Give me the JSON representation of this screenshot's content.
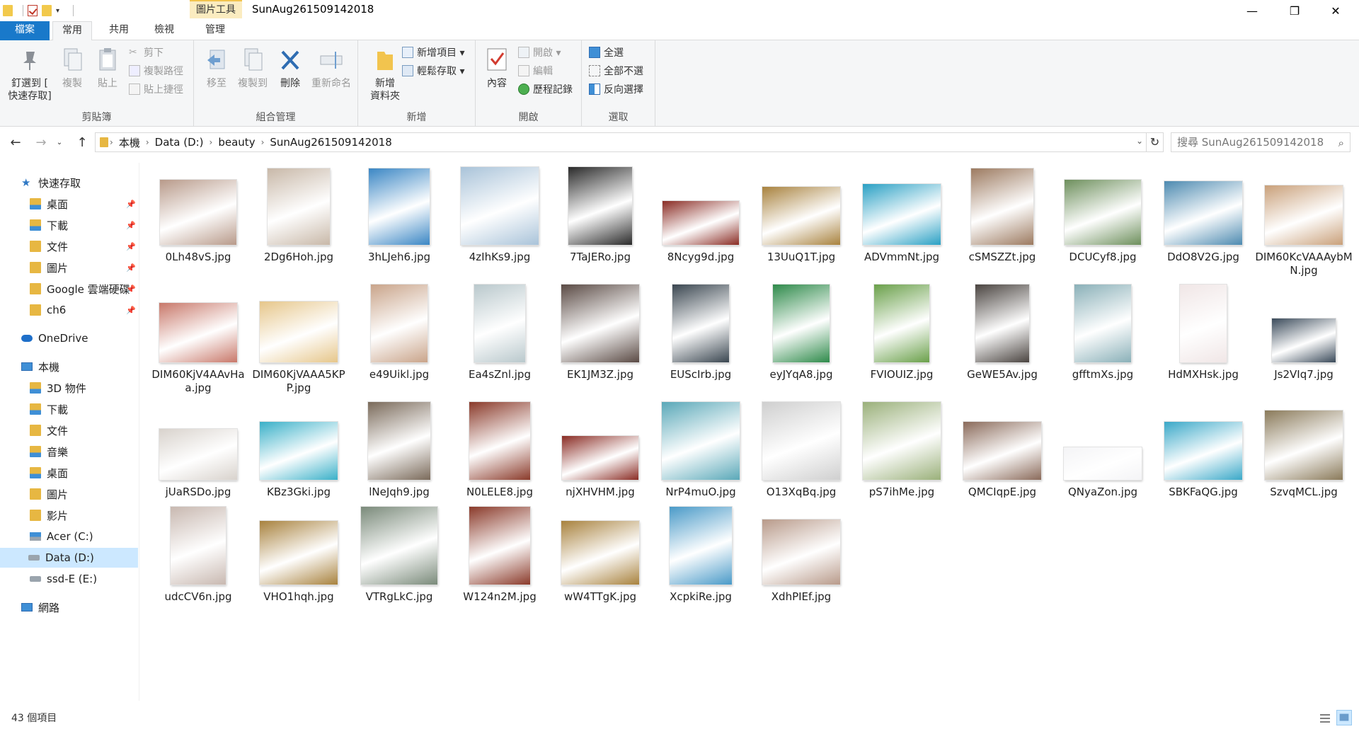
{
  "window": {
    "title": "SunAug261509142018",
    "tool_tab": "圖片工具",
    "minimize": "—",
    "restore": "❐",
    "close": "✕"
  },
  "tabs": {
    "file": "檔案",
    "home": "常用",
    "share": "共用",
    "view": "檢視",
    "manage": "管理"
  },
  "ribbon": {
    "clipboard": {
      "label": "剪貼簿",
      "pin": "釘選到 [\n快速存取]",
      "copy": "複製",
      "paste": "貼上",
      "cut": "剪下",
      "copy_path": "複製路徑",
      "paste_shortcut": "貼上捷徑"
    },
    "organize": {
      "label": "組合管理",
      "move": "移至",
      "copy_to": "複製到",
      "delete": "刪除",
      "rename": "重新命名"
    },
    "new": {
      "label": "新增",
      "new_folder": "新增\n資料夾",
      "new_item": "新增項目 ▾",
      "easy_access": "輕鬆存取 ▾"
    },
    "open": {
      "label": "開啟",
      "properties": "內容",
      "open": "開啟 ▾",
      "edit": "編輯",
      "history": "歷程記錄"
    },
    "select": {
      "label": "選取",
      "select_all": "全選",
      "select_none": "全部不選",
      "invert": "反向選擇"
    }
  },
  "address": {
    "crumbs": [
      "本機",
      "Data (D:)",
      "beauty",
      "SunAug261509142018"
    ],
    "search_placeholder": "搜尋 SunAug261509142018"
  },
  "sidebar": {
    "quick_access": "快速存取",
    "qa_items": [
      "桌面",
      "下載",
      "文件",
      "圖片",
      "Google 雲端硬碟",
      "ch6"
    ],
    "onedrive": "OneDrive",
    "this_pc": "本機",
    "pc_items": [
      "3D 物件",
      "下載",
      "文件",
      "音樂",
      "桌面",
      "圖片",
      "影片",
      "Acer (C:)",
      "Data (D:)",
      "ssd-E (E:)"
    ],
    "network": "網路"
  },
  "files": [
    {
      "name": "0Lh48vS.jpg",
      "color": "#b89a8a"
    },
    {
      "name": "2Dg6Hoh.jpg",
      "color": "#c8b8a8"
    },
    {
      "name": "3hLJeh6.jpg",
      "color": "#3a86c4"
    },
    {
      "name": "4zIhKs9.jpg",
      "color": "#a9c3d9"
    },
    {
      "name": "7TaJERo.jpg",
      "color": "#2a2a2a"
    },
    {
      "name": "8Ncyg9d.jpg",
      "color": "#8a2c24"
    },
    {
      "name": "13UuQ1T.jpg",
      "color": "#a8823e"
    },
    {
      "name": "ADVmmNt.jpg",
      "color": "#2aa0c4"
    },
    {
      "name": "cSMSZZt.jpg",
      "color": "#9c7a60"
    },
    {
      "name": "DCUCyf8.jpg",
      "color": "#6d8f5c"
    },
    {
      "name": "DdO8V2G.jpg",
      "color": "#4d8ab0"
    },
    {
      "name": "DIM60KcVAAAybMN.jpg",
      "color": "#c9a07a"
    },
    {
      "name": "DIM60KjV4AAvHaa.jpg",
      "color": "#c8786a"
    },
    {
      "name": "DIM60KjVAAA5KPP.jpg",
      "color": "#e6c68a"
    },
    {
      "name": "e49Uikl.jpg",
      "color": "#c9a48a"
    },
    {
      "name": "Ea4sZnl.jpg",
      "color": "#b9c8cc"
    },
    {
      "name": "EK1JM3Z.jpg",
      "color": "#5a4a44"
    },
    {
      "name": "EUScIrb.jpg",
      "color": "#3a4650"
    },
    {
      "name": "eyJYqA8.jpg",
      "color": "#2e8a4a"
    },
    {
      "name": "FVIOUIZ.jpg",
      "color": "#6aa04a"
    },
    {
      "name": "GeWE5Av.jpg",
      "color": "#4a4440"
    },
    {
      "name": "gfftmXs.jpg",
      "color": "#8ab0b8"
    },
    {
      "name": "HdMXHsk.jpg",
      "color": "#f0e6e6"
    },
    {
      "name": "Js2VIq7.jpg",
      "color": "#3a4a5a"
    },
    {
      "name": "jUaRSDo.jpg",
      "color": "#d8d2cc"
    },
    {
      "name": "KBz3Gki.jpg",
      "color": "#3ab0c8"
    },
    {
      "name": "lNeJqh9.jpg",
      "color": "#7a6a5a"
    },
    {
      "name": "N0LELE8.jpg",
      "color": "#8a3a2a"
    },
    {
      "name": "njXHVHM.jpg",
      "color": "#8a2c24"
    },
    {
      "name": "NrP4muO.jpg",
      "color": "#5aa8b8"
    },
    {
      "name": "O13XqBq.jpg",
      "color": "#cfcfcf"
    },
    {
      "name": "pS7ihMe.jpg",
      "color": "#9ab07a"
    },
    {
      "name": "QMCIqpE.jpg",
      "color": "#8a6a5a"
    },
    {
      "name": "QNyaZon.jpg",
      "color": "#f4f4f6"
    },
    {
      "name": "SBKFaQG.jpg",
      "color": "#3aa8c8"
    },
    {
      "name": "SzvqMCL.jpg",
      "color": "#8a7a5a"
    },
    {
      "name": "udcCV6n.jpg",
      "color": "#c8b8b0"
    },
    {
      "name": "VHO1hqh.jpg",
      "color": "#a8823e"
    },
    {
      "name": "VTRgLkC.jpg",
      "color": "#7a8a7a"
    },
    {
      "name": "W124n2M.jpg",
      "color": "#8a3a2a"
    },
    {
      "name": "wW4TTgK.jpg",
      "color": "#a8823e"
    },
    {
      "name": "XcpkiRe.jpg",
      "color": "#4a9ac8"
    },
    {
      "name": "XdhPIEf.jpg",
      "color": "#b89a8a"
    }
  ],
  "status": {
    "count": "43 個項目"
  },
  "colors": {
    "accent": "#1979ca",
    "selection": "#cce8ff",
    "tool_tab": "#fbecc0"
  }
}
